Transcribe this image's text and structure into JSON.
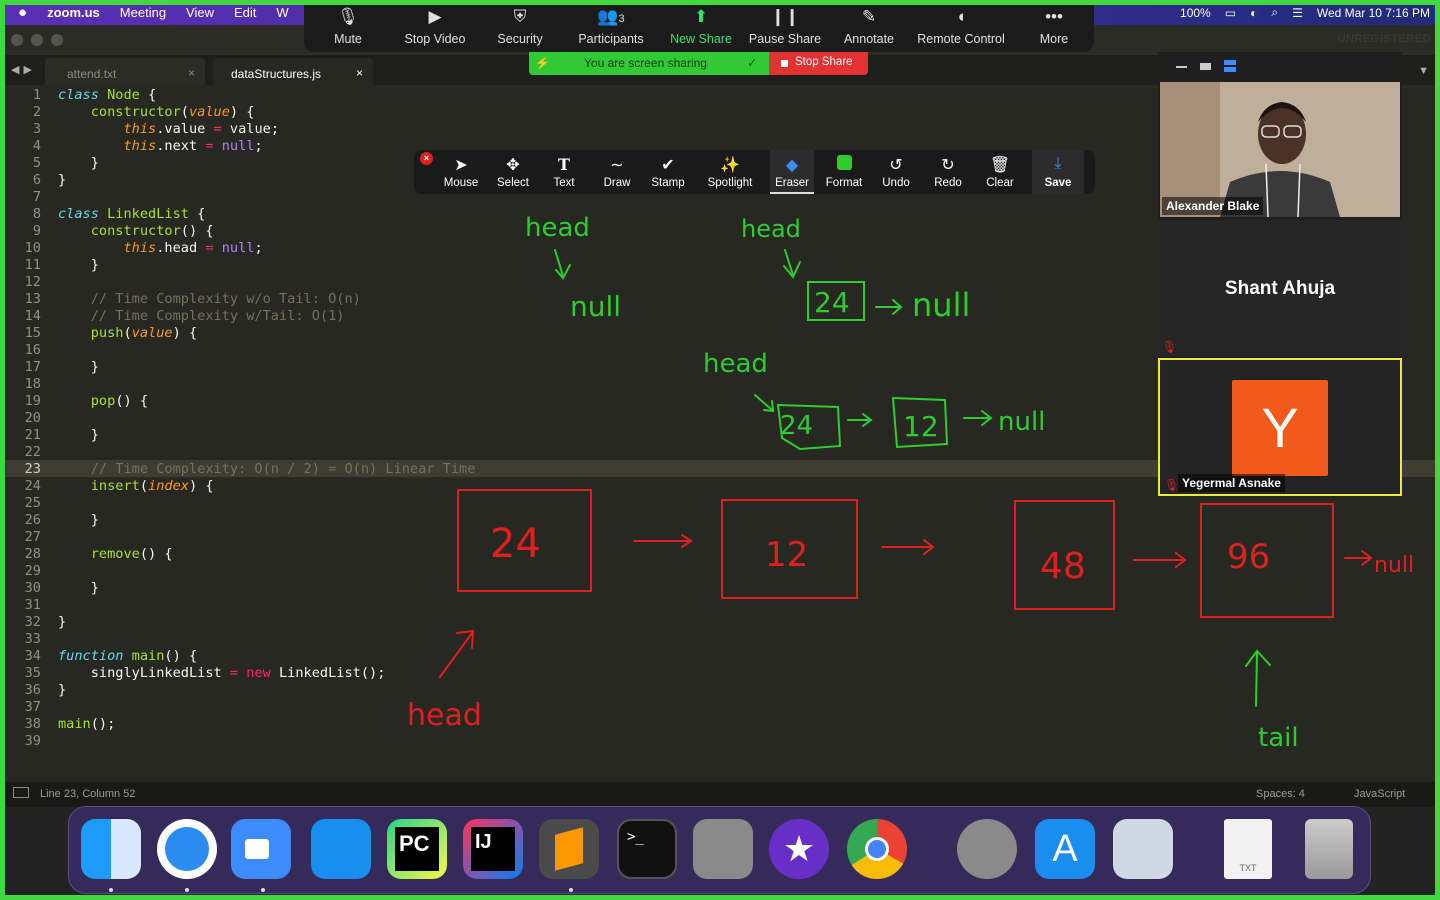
{
  "menubar": {
    "apple": "",
    "app": "zoom.us",
    "items": [
      "Meeting",
      "View",
      "Edit",
      "W"
    ],
    "battery": "100%",
    "datetime": "Wed Mar 10  7:16 PM"
  },
  "zoom_toolbar": {
    "mute": "Mute",
    "stop_video": "Stop Video",
    "security": "Security",
    "participants": "Participants",
    "participants_count": "3",
    "new_share": "New Share",
    "pause_share": "Pause Share",
    "annotate": "Annotate",
    "remote_control": "Remote Control",
    "more": "More"
  },
  "share_status": {
    "text": "You are screen sharing",
    "stop": "Stop Share"
  },
  "annotate_toolbar": {
    "mouse": "Mouse",
    "select": "Select",
    "text": "Text",
    "draw": "Draw",
    "stamp": "Stamp",
    "spotlight": "Spotlight",
    "eraser": "Eraser",
    "format": "Format",
    "undo": "Undo",
    "redo": "Redo",
    "clear": "Clear",
    "save": "Save"
  },
  "editor": {
    "unregistered": "UNREGISTERED",
    "tabs": [
      {
        "label": "attend.txt",
        "active": false
      },
      {
        "label": "dataStructures.js",
        "active": true
      }
    ],
    "current_line": 23,
    "status": {
      "position": "Line 23, Column 52",
      "spaces": "Spaces: 4",
      "syntax": "JavaScript"
    }
  },
  "participants": [
    {
      "name": "Alexander Blake",
      "video": true
    },
    {
      "name": "Shant Ahuja",
      "video": false
    },
    {
      "name": "Yegermal Asnake",
      "video": false,
      "initial": "Y",
      "active_speaker": true
    }
  ],
  "annotations": {
    "green": {
      "head1": "head",
      "null1": "null",
      "head2": "head",
      "val2": "24",
      "null2": "null",
      "head3": "head",
      "val3a": "24",
      "val3b": "12",
      "null3": "null"
    },
    "red": {
      "nodes": [
        "24",
        "12",
        "48",
        "96"
      ],
      "null": "null",
      "head": "head",
      "tail": "tail"
    }
  },
  "dock": [
    "Finder",
    "Safari",
    "Zoom",
    "Xcode",
    "PyCharm",
    "IntelliJ IDEA",
    "Sublime Text",
    "Terminal",
    "Calculator",
    "iMovie",
    "Chrome",
    "System Preferences",
    "App Store",
    "Preview",
    "TXT",
    "Trash"
  ],
  "colors": {
    "share_border": "#42d63f",
    "pen_green": "#2ecc2e",
    "pen_red": "#e02020",
    "menubar": "#4a2fa8"
  }
}
